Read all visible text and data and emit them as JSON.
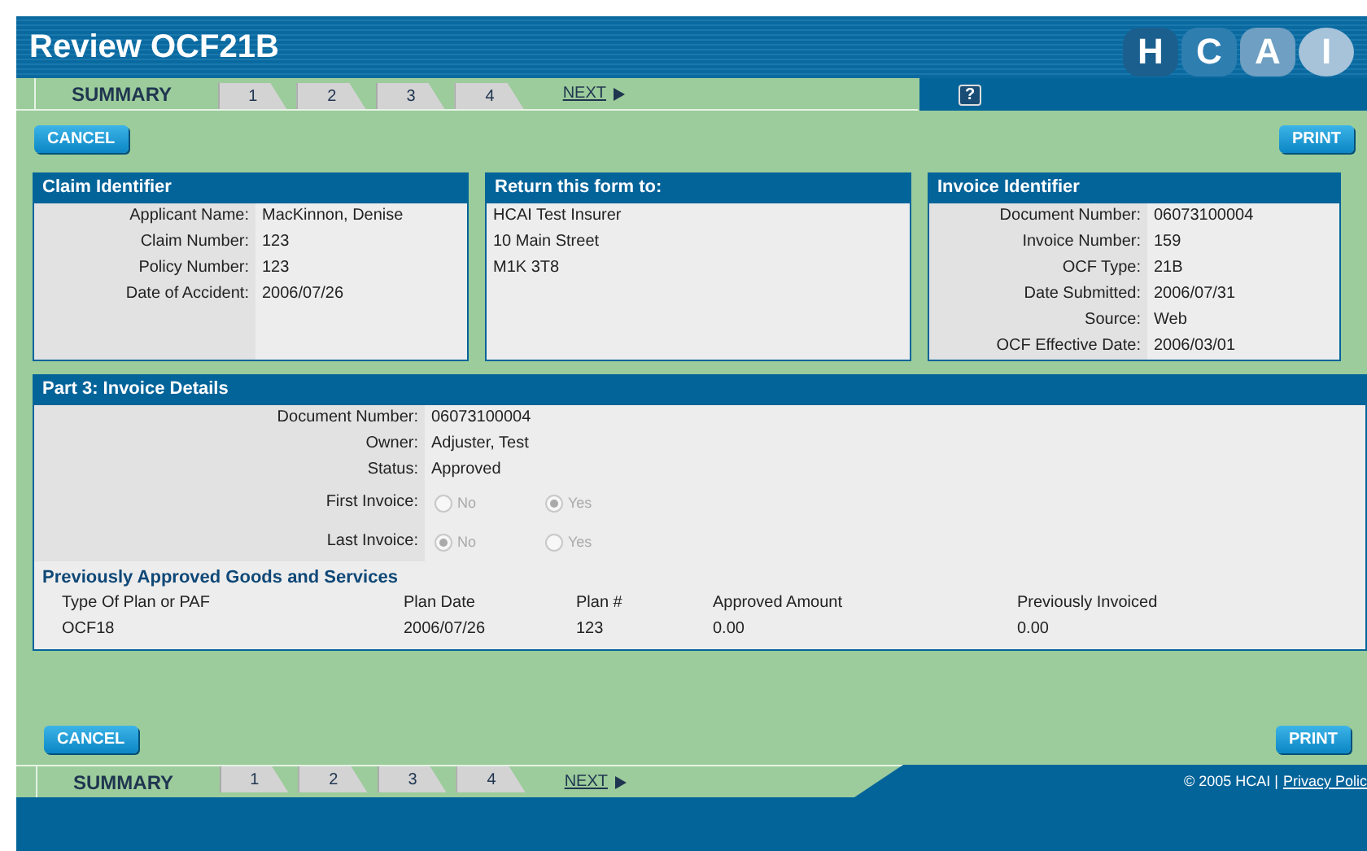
{
  "header": {
    "title": "Review OCF21B",
    "logo": [
      "H",
      "C",
      "A",
      "I"
    ],
    "help": "?"
  },
  "tabs": [
    {
      "label": "SUMMARY",
      "selected": true
    },
    {
      "label": "1",
      "selected": false
    },
    {
      "label": "2",
      "selected": false
    },
    {
      "label": "3",
      "selected": false
    },
    {
      "label": "4",
      "selected": false
    }
  ],
  "next": "NEXT",
  "actions": {
    "cancel": "CANCEL",
    "print": "PRINT"
  },
  "claim_identifier": {
    "title": "Claim Identifier",
    "fields": [
      {
        "label": "Applicant Name:",
        "value": "MacKinnon, Denise"
      },
      {
        "label": "Claim Number:",
        "value": "123"
      },
      {
        "label": "Policy Number:",
        "value": "123"
      },
      {
        "label": "Date of Accident:",
        "value": "2006/07/26"
      }
    ]
  },
  "return_to": {
    "title": "Return this form to:",
    "lines": [
      "HCAI Test Insurer",
      "10 Main Street",
      "M1K 3T8"
    ]
  },
  "invoice_identifier": {
    "title": "Invoice Identifier",
    "fields": [
      {
        "label": "Document Number:",
        "value": "06073100004"
      },
      {
        "label": "Invoice Number:",
        "value": "159"
      },
      {
        "label": "OCF Type:",
        "value": "21B"
      },
      {
        "label": "Date Submitted:",
        "value": "2006/07/31"
      },
      {
        "label": "Source:",
        "value": "Web"
      },
      {
        "label": "OCF Effective Date:",
        "value": "2006/03/01"
      }
    ]
  },
  "invoice_details": {
    "title": "Part 3: Invoice Details",
    "fields": [
      {
        "label": "Document Number:",
        "value": "06073100004"
      },
      {
        "label": "Owner:",
        "value": "Adjuster, Test"
      },
      {
        "label": "Status:",
        "value": "Approved"
      }
    ],
    "radio_groups": [
      {
        "label": "First Invoice:",
        "disabled": true,
        "options": [
          {
            "label": "No",
            "selected": false
          },
          {
            "label": "Yes",
            "selected": true
          }
        ]
      },
      {
        "label": "Last Invoice:",
        "disabled": true,
        "options": [
          {
            "label": "No",
            "selected": true
          },
          {
            "label": "Yes",
            "selected": false
          }
        ]
      }
    ],
    "goods_title": "Previously Approved Goods and Services",
    "table": {
      "columns": [
        "Type Of Plan or PAF",
        "Plan Date",
        "Plan #",
        "Approved Amount",
        "Previously Invoiced"
      ],
      "rows": [
        [
          "OCF18",
          "2006/07/26",
          "123",
          "0.00",
          "0.00"
        ]
      ]
    }
  },
  "bottom_actions": {
    "cancel": "CANCEL",
    "print": "PRINT"
  },
  "footer": {
    "tabs": [
      {
        "label": "SUMMARY",
        "selected": true
      },
      {
        "label": "1",
        "selected": false
      },
      {
        "label": "2",
        "selected": false
      },
      {
        "label": "3",
        "selected": false
      },
      {
        "label": "4",
        "selected": false
      }
    ],
    "next": "NEXT",
    "copyright": "© 2005 HCAI |",
    "privacy": "Privacy Polic"
  }
}
